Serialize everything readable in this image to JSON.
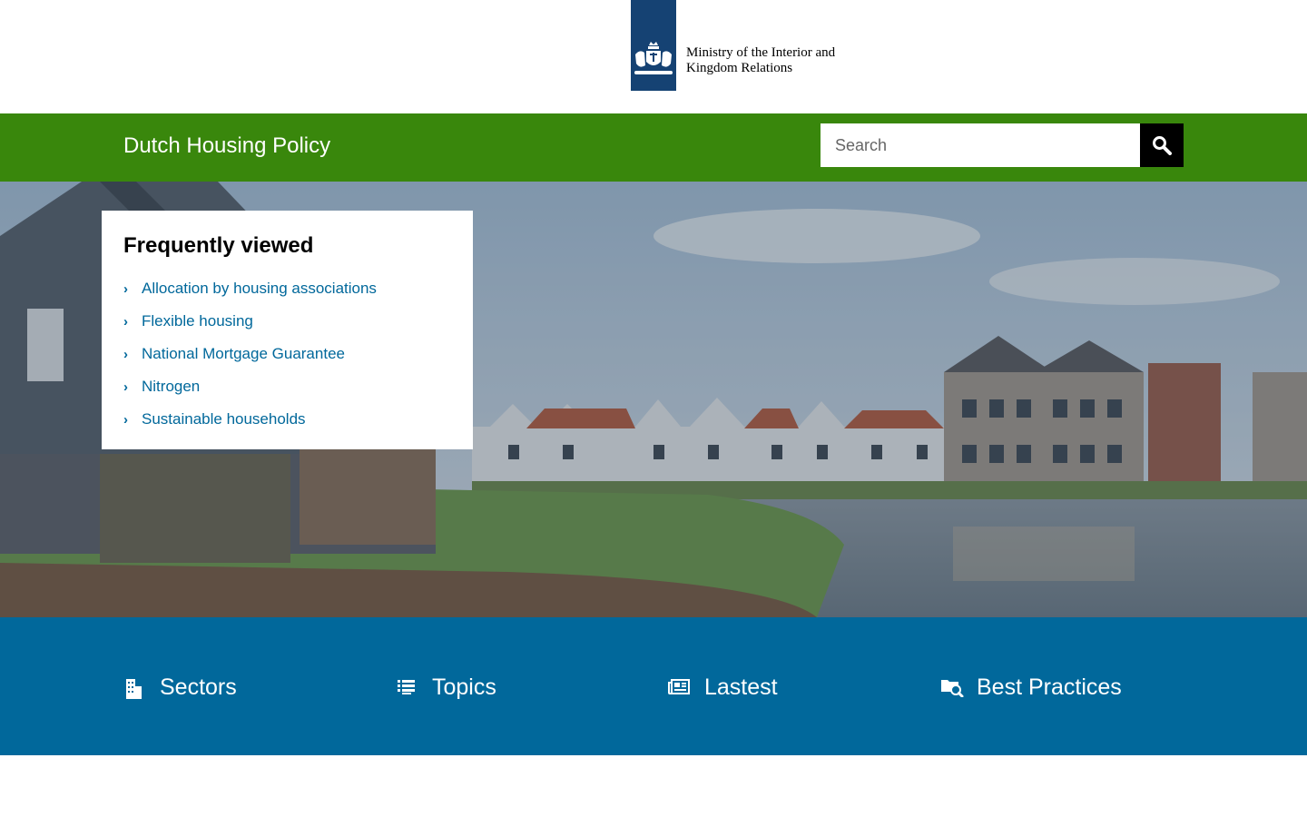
{
  "masthead": {
    "org_line1": "Ministry of the Interior and",
    "org_line2": "Kingdom Relations",
    "emblem_icon": "coat-of-arms-icon",
    "brand_color": "#154273"
  },
  "sitebar": {
    "title": "Dutch Housing Policy",
    "background": "#39870c",
    "search": {
      "placeholder": "Search",
      "value": "",
      "button_icon": "search-icon"
    }
  },
  "hero": {
    "image": "houses-by-canal-photo",
    "frequently_viewed": {
      "title": "Frequently viewed",
      "items": [
        {
          "label": "Allocation by housing associations"
        },
        {
          "label": "Flexible housing"
        },
        {
          "label": "National Mortgage Guarantee"
        },
        {
          "label": "Nitrogen"
        },
        {
          "label": "Sustainable households"
        }
      ]
    }
  },
  "nav": {
    "background": "#01689b",
    "items": [
      {
        "label": "Sectors",
        "icon": "sectors-building-icon"
      },
      {
        "label": "Topics",
        "icon": "list-icon"
      },
      {
        "label": "Lastest",
        "icon": "newspaper-icon"
      },
      {
        "label": "Best Practices",
        "icon": "folder-search-icon"
      }
    ]
  }
}
